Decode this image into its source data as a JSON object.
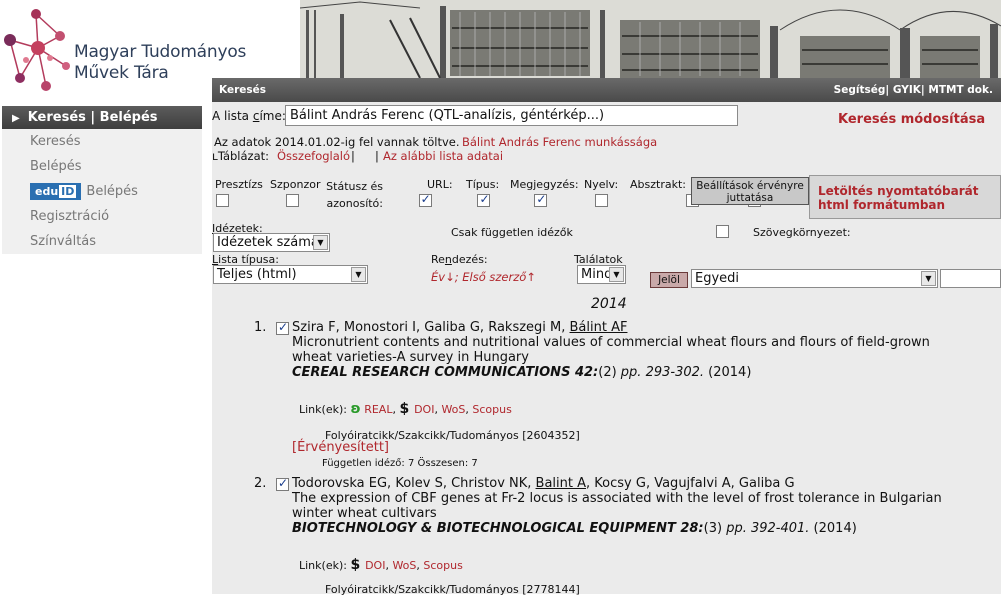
{
  "logo": {
    "line1": "Magyar Tudományos",
    "line2": "Művek Tára"
  },
  "topbar": {
    "title": "Keresés",
    "links": [
      "Segítség",
      "GYIK",
      "MTMT dok."
    ]
  },
  "sidebar": {
    "header": "Keresés | Belépés",
    "items": [
      {
        "label": "Keresés"
      },
      {
        "label": "Belépés"
      },
      {
        "label": "Belépés",
        "badge": "edu ID"
      },
      {
        "label": "Regisztráció"
      },
      {
        "label": "Színváltás"
      }
    ]
  },
  "search": {
    "list_title_label": "A lista címe:",
    "list_title_value": "Bálint András Ferenc (QTL-analízis, géntérkép...)",
    "modify_link": "Keresés módosítása",
    "data_loaded": "Az adatok 2014.01.02-ig fel vannak töltve.",
    "author_works_link": "Bálint András Ferenc munkássága",
    "table_label": "Táblázat:",
    "summary_link": "Összefoglaló",
    "list_data_link": "Az alábbi lista adatai"
  },
  "options": {
    "columns": [
      {
        "label": "Presztízs",
        "checked": false
      },
      {
        "label": "Szponzor",
        "checked": false
      },
      {
        "label": "Státusz és azonosító:",
        "checked": true
      },
      {
        "label": "URL:",
        "checked": true
      },
      {
        "label": "Típus:",
        "checked": true
      },
      {
        "label": "Megjegyzés:",
        "checked": false
      },
      {
        "label": "Nyelv:",
        "checked": false
      },
      {
        "label": "Absztrakt:",
        "checked": false
      }
    ],
    "apply_button": "Beállítások érvényre juttatása",
    "print_link": "Letöltés nyomtatóbarát html formátumban",
    "citations_label": "Idézetek:",
    "citations_value": "Idézetek száma",
    "independent_label": "Csak független idézők",
    "context_label": "Szövegkörnyezet:",
    "list_type_label": "Lista típusa:",
    "list_type_value": "Teljes (html)",
    "sort_label": "Rendezés:",
    "sort_value": "Év↓; Első szerző↑",
    "hits_label": "Találatok",
    "hits_value": "Mind",
    "mark_button": "Jelöl",
    "mark_value": "Egyedi"
  },
  "year_heading": "2014",
  "entries": [
    {
      "num": "1.",
      "checked": true,
      "authors_before": "Szira F, Monostori I, Galiba G, Rakszegi M, ",
      "author_highlight": "Bálint AF",
      "authors_after": "",
      "title": "Micronutrient contents and nutritional values of commercial wheat flours and flours of field-grown wheat varieties-A survey in Hungary",
      "journal": "CEREAL RESEARCH COMMUNICATIONS 42:",
      "issue": "(2)",
      "pages": " pp. 293-302.",
      "year": " (2014)",
      "links_label": "Link(ek):",
      "links": [
        "REAL",
        "DOI",
        "WoS",
        "Scopus"
      ],
      "type": "Folyóiratcikk/Szakcikk/Tudományos [2604352]",
      "status": "[Érvényesített]",
      "citations": "Független idéző: 7 Összesen: 7"
    },
    {
      "num": "2.",
      "checked": true,
      "authors_before": "Todorovska EG, Kolev S, Christov NK, ",
      "author_highlight": "Balint A",
      "authors_after": ", Kocsy G, Vagujfalvi A, Galiba G",
      "title": "The expression of CBF genes at Fr-2 locus is associated with the level of frost tolerance in Bulgarian winter wheat cultivars",
      "journal": "BIOTECHNOLOGY & BIOTECHNOLOGICAL EQUIPMENT 28:",
      "issue": "(3)",
      "pages": " pp. 392-401.",
      "year": " (2014)",
      "links_label": "Link(ek):",
      "links": [
        "DOI",
        "WoS",
        "Scopus"
      ],
      "type": "Folyóiratcikk/Szakcikk/Tudományos [2778144]"
    }
  ]
}
